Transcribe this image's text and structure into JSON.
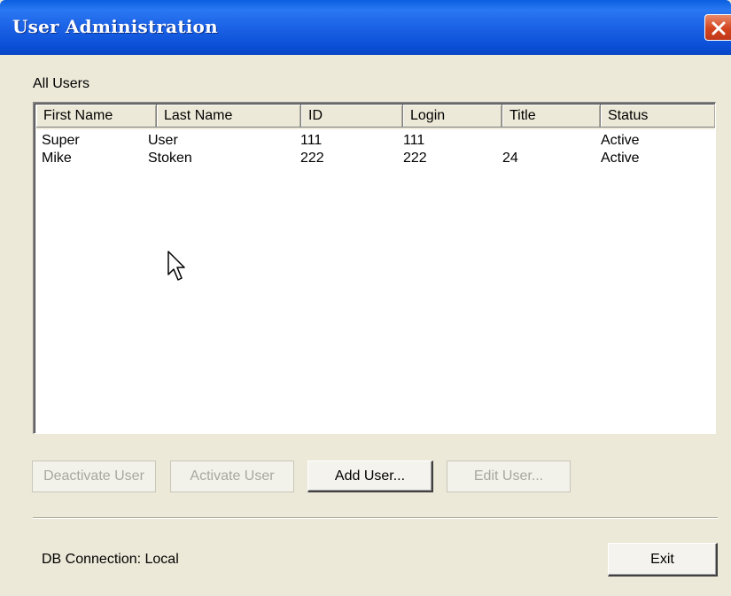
{
  "window": {
    "title": "User Administration",
    "titlebar_color": "#0a4fd6",
    "close_icon": "close-icon",
    "close_color": "#d4451f"
  },
  "group": {
    "label": "All Users"
  },
  "table": {
    "columns": [
      "First Name",
      "Last Name",
      "ID",
      "Login",
      "Title",
      "Status"
    ],
    "rows": [
      [
        "Super",
        "User",
        "111",
        "111",
        "",
        "Active"
      ],
      [
        "Mike",
        "Stoken",
        "222",
        "222",
        "24",
        "Active"
      ]
    ]
  },
  "buttons": {
    "deactivate": "Deactivate User",
    "activate": "Activate User",
    "add": "Add User...",
    "edit": "Edit User...",
    "exit": "Exit"
  },
  "status": {
    "db_connection": "DB Connection: Local"
  },
  "cursor_icon": "mouse-pointer-icon"
}
